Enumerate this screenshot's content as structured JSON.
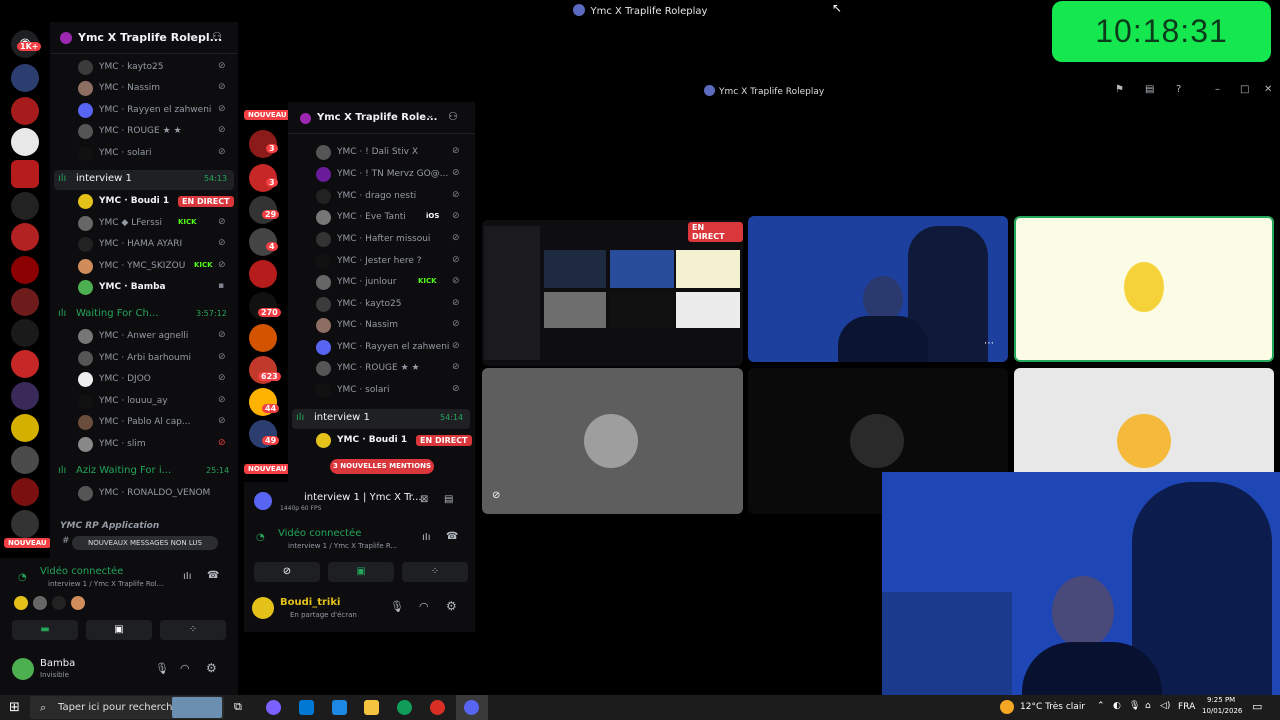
{
  "window": {
    "title": "Ymc X Traplife Roleplay"
  },
  "clock": "10:18:31",
  "rail": {
    "badge_top": "1K+",
    "badge_new": "NOUVEAU"
  },
  "outer_channels": {
    "server_name": "Ymc X Traplife Rolepl...",
    "top_users": [
      {
        "name": "YMC · kayto25"
      },
      {
        "name": "YMC · Nassim"
      },
      {
        "name": "YMC · Rayyen el zahweni"
      },
      {
        "name": "YMC · ROUGE ★ ★"
      },
      {
        "name": "YMC · solari"
      }
    ],
    "interview": {
      "label": "interview 1",
      "time": "54:13",
      "users": [
        {
          "name": "YMC · Boudi 1",
          "live": "EN DIRECT"
        },
        {
          "name": "YMC ◆ LFerssi",
          "tag": "KICK"
        },
        {
          "name": "YMC · HAMA AYARI"
        },
        {
          "name": "YMC · YMC_SKIZOU",
          "tag": "KICK"
        },
        {
          "name": "YMC · Bamba"
        }
      ]
    },
    "waiting": {
      "label": "Waiting For Ch...",
      "time": "3:57:12",
      "users": [
        {
          "name": "YMC · Anwer agnelli"
        },
        {
          "name": "YMC · Arbi barhoumi"
        },
        {
          "name": "YMC · DJOO"
        },
        {
          "name": "YMC · louuu_ay"
        },
        {
          "name": "YMC · Pablo Al cap..."
        },
        {
          "name": "YMC · slim"
        }
      ]
    },
    "aziz": {
      "label": "Aziz Waiting For i...",
      "time": "25:14",
      "users": [
        {
          "name": "YMC · RONALDO_VENOM"
        }
      ]
    },
    "application": "YMC RP Application",
    "unread_pill": "NOUVEAUX MESSAGES NON LUS",
    "voice": {
      "status": "Vidéo connectée",
      "channel": "interview 1 / Ymc X Traplife Rol..."
    },
    "user": {
      "name": "Bamba",
      "status": "Invisible"
    }
  },
  "inner": {
    "title": "Ymc X Traplife Roleplay",
    "badge_new": "NOUVEAU",
    "server_name": "Ymc X Traplife Role...",
    "users_top": [
      {
        "name": "YMC · ! Dali Stiv X"
      },
      {
        "name": "YMC · ! TN Mervz GO@..."
      },
      {
        "name": "YMC · drago nesti"
      },
      {
        "name": "YMC · Eve Tanti",
        "tag": "iOS"
      },
      {
        "name": "YMC · Hafter missoui"
      },
      {
        "name": "YMC · Jester here ?"
      },
      {
        "name": "YMC · junlour",
        "tag": "KICK"
      },
      {
        "name": "YMC · kayto25"
      },
      {
        "name": "YMC · Nassim"
      },
      {
        "name": "YMC · Rayyen el zahweni"
      },
      {
        "name": "YMC · ROUGE ★ ★"
      },
      {
        "name": "YMC · solari"
      }
    ],
    "interview": {
      "label": "interview 1",
      "time": "54:14",
      "user": "YMC · Boudi 1",
      "live": "EN DIRECT"
    },
    "mentions_pill": "3 NOUVELLES MENTIONS",
    "stream": {
      "title": "interview 1 | Ymc X Tr...",
      "quality": "1440p 60 FPS"
    },
    "voice": {
      "status": "Vidéo connectée",
      "channel": "interview 1 / Ymc X Traplife R..."
    },
    "user": {
      "name": "Boudi_triki",
      "status": "En partage d'écran"
    },
    "rail_counts": [
      "3",
      "3",
      "29",
      "4",
      "270",
      "623",
      "44",
      "49"
    ],
    "live_tile": "EN DIRECT"
  },
  "taskbar": {
    "search_placeholder": "Taper ici pour rechercher",
    "weather": "12°C Très clair",
    "lang": "FRA",
    "time": "9:25 PM",
    "date": "10/01/2026"
  },
  "colors": {
    "live": "#da373c",
    "connected": "#23a55a",
    "clock_bg": "#15e84f",
    "badge": "#f23f43"
  }
}
